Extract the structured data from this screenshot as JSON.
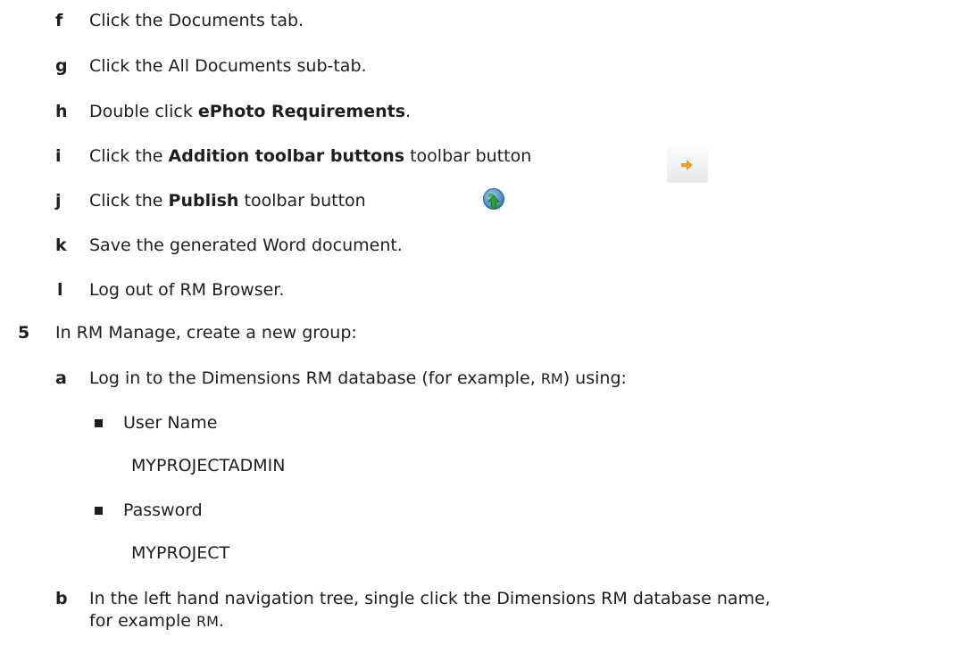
{
  "steps_f_to_l": [
    {
      "label": "f",
      "text": "Click the Documents tab."
    },
    {
      "label": "g",
      "text": "Click the All Documents sub-tab."
    },
    {
      "label": "h",
      "pre": "Double click ",
      "bold": "ePhoto Requirements",
      "post": "."
    },
    {
      "label": "i",
      "pre": "Click the ",
      "bold": "Addition toolbar buttons",
      "post": " toolbar button"
    },
    {
      "label": "j",
      "pre": "Click the ",
      "bold": "Publish",
      "post": " toolbar button"
    },
    {
      "label": "k",
      "text": "Save the generated Word document."
    },
    {
      "label": "l",
      "text": "Log out of RM Browser."
    }
  ],
  "step5": {
    "number": "5",
    "text": "In RM Manage, create a new group:",
    "a": {
      "label": "a",
      "pre": "Log in to the Dimensions RM database (for example, ",
      "code": "RM",
      "post": ") using:",
      "items": [
        {
          "name": "User Name",
          "value": "MYPROJECTADMIN"
        },
        {
          "name": "Password",
          "value": "MYPROJECT"
        }
      ]
    },
    "b": {
      "label": "b",
      "line1": "In the left hand navigation tree, single click the Dimensions RM database name,",
      "line2_pre": "for example ",
      "line2_code": "RM",
      "line2_post": "."
    }
  },
  "icons": {
    "addition": "addition-arrow-icon",
    "publish": "publish-globe-icon",
    "addition_color": "#f0a020",
    "publish_color": "#3a8fd0"
  }
}
